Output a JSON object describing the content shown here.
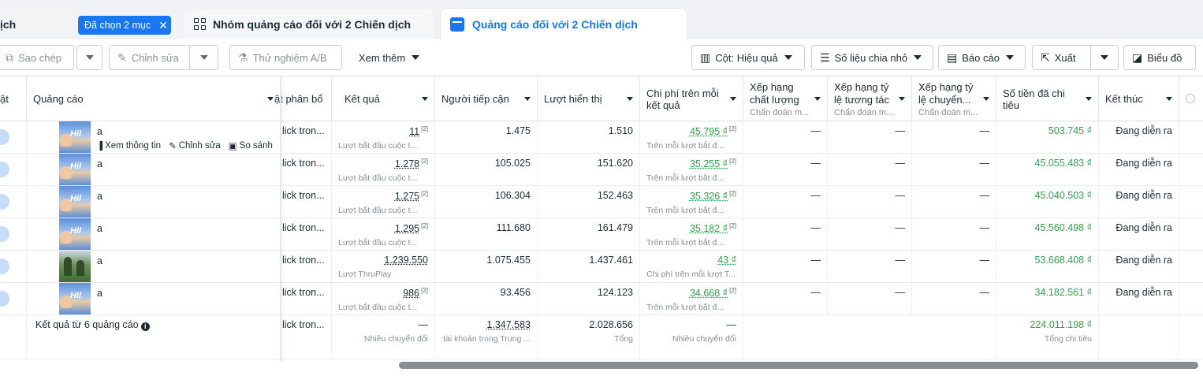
{
  "tabs": {
    "campaigns_label": "ịch",
    "selected_chip": "Đã chọn 2 mục",
    "ad_sets_label": "Nhóm quảng cáo đối với 2 Chiến dịch",
    "ads_label": "Quảng cáo đối với 2 Chiến dịch"
  },
  "toolbar": {
    "duplicate": "Sao chép",
    "edit": "Chỉnh sửa",
    "ab_test": "Thử nghiệm A/B",
    "more": "Xem thêm",
    "columns": "Cột: Hiệu quả",
    "breakdown": "Số liệu chia nhỏ",
    "reports": "Báo cáo",
    "export": "Xuất",
    "charts": "Biểu đồ"
  },
  "columns": {
    "status": "ật",
    "ad": "Quảng cáo",
    "delivery": "ật phân bổ",
    "results": "Kết quả",
    "reach": "Người tiếp cận",
    "impressions": "Lượt hiển thị",
    "cost_per_result": "Chi phí trên mỗi kết quả",
    "quality_ranking": "Xếp hạng chất lượng",
    "quality_ranking_sub": "Chẩn đoán m...",
    "engagement_ranking": "Xếp hạng tỷ lệ tương tác",
    "engagement_ranking_sub": "Chẩn đoán m...",
    "conversion_ranking": "Xếp hạng tỷ lệ chuyển...",
    "conversion_ranking_sub": "Chẩn đoán m...",
    "amount_spent": "Số tiền đã chi tiêu",
    "ends": "Kết thúc"
  },
  "row_actions": {
    "view": "Xem thông tin",
    "edit": "Chỉnh sửa",
    "compare": "So sánh",
    "more": "•••"
  },
  "rows": [
    {
      "name": "a",
      "delivery": "lick tron...",
      "result": "11",
      "result_note": "[2]",
      "result_sub": "Lượt bắt đầu cuộc t...",
      "reach": "1.475",
      "impressions": "1.510",
      "cpr": "45.795 ₫",
      "cpr_note": "[2]",
      "cpr_sub": "Trên mỗi lượt bắt đ...",
      "quality": "—",
      "engagement": "—",
      "conversion": "—",
      "spent": "503.745 ₫",
      "ends": "Đang diễn ra",
      "thumb": "hil"
    },
    {
      "name": "a",
      "delivery": "lick tron...",
      "result": "1.278",
      "result_note": "[2]",
      "result_sub": "Lượt bắt đầu cuộc t...",
      "reach": "105.025",
      "impressions": "151.620",
      "cpr": "35.255 ₫",
      "cpr_note": "[2]",
      "cpr_sub": "Trên mỗi lượt bắt đ...",
      "quality": "—",
      "engagement": "—",
      "conversion": "—",
      "spent": "45.055.483 ₫",
      "ends": "Đang diễn ra",
      "thumb": "hil"
    },
    {
      "name": "a",
      "delivery": "lick tron...",
      "result": "1.275",
      "result_note": "[2]",
      "result_sub": "Lượt bắt đầu cuộc t...",
      "reach": "106.304",
      "impressions": "152.463",
      "cpr": "35.326 ₫",
      "cpr_note": "[2]",
      "cpr_sub": "Trên mỗi lượt bắt đ...",
      "quality": "—",
      "engagement": "—",
      "conversion": "—",
      "spent": "45.040.503 ₫",
      "ends": "Đang diễn ra",
      "thumb": "hil"
    },
    {
      "name": "a",
      "delivery": "lick tron...",
      "result": "1.295",
      "result_note": "[2]",
      "result_sub": "Lượt bắt đầu cuộc t...",
      "reach": "111.680",
      "impressions": "161.479",
      "cpr": "35.182 ₫",
      "cpr_note": "[2]",
      "cpr_sub": "Trên mỗi lượt bắt đ...",
      "quality": "—",
      "engagement": "—",
      "conversion": "—",
      "spent": "45.560.498 ₫",
      "ends": "Đang diễn ra",
      "thumb": "hil"
    },
    {
      "name": "a",
      "delivery": "lick tron...",
      "result": "1.239.550",
      "result_note": "",
      "result_sub": "Lượt ThruPlay",
      "reach": "1.075.455",
      "impressions": "1.437.461",
      "cpr": "43 ₫",
      "cpr_note": "",
      "cpr_sub": "Chi phí trên mỗi lượt T...",
      "quality": "—",
      "engagement": "—",
      "conversion": "—",
      "spent": "53.668.408 ₫",
      "ends": "Đang diễn ra",
      "thumb": "nature"
    },
    {
      "name": "a",
      "delivery": "lick tron...",
      "result": "986",
      "result_note": "[2]",
      "result_sub": "Lượt bắt đầu cuộc t...",
      "reach": "93.456",
      "impressions": "124.123",
      "cpr": "34.668 ₫",
      "cpr_note": "[2]",
      "cpr_sub": "Trên mỗi lượt bắt đ...",
      "quality": "—",
      "engagement": "—",
      "conversion": "—",
      "spent": "34.182.561 ₫",
      "ends": "Đang diễn ra",
      "thumb": "hil"
    }
  ],
  "summary": {
    "label": "Kết quả từ 6 quảng cáo",
    "delivery": "lick tron...",
    "result": "—",
    "result_sub": "Nhiều chuyển đổi",
    "reach": "1.347.583",
    "reach_sub": "tài khoản trong Trung ...",
    "impressions": "2.028.656",
    "impressions_sub": "Tổng",
    "cpr": "—",
    "cpr_sub": "Nhiều chuyển đổi",
    "spent": "224.011.198 ₫",
    "spent_sub": "Tổng chi tiêu"
  },
  "thumbnail_text": "Hil",
  "colors": {
    "accent": "#1877f2",
    "positive": "#31a24c",
    "muted": "#8a8d91"
  }
}
